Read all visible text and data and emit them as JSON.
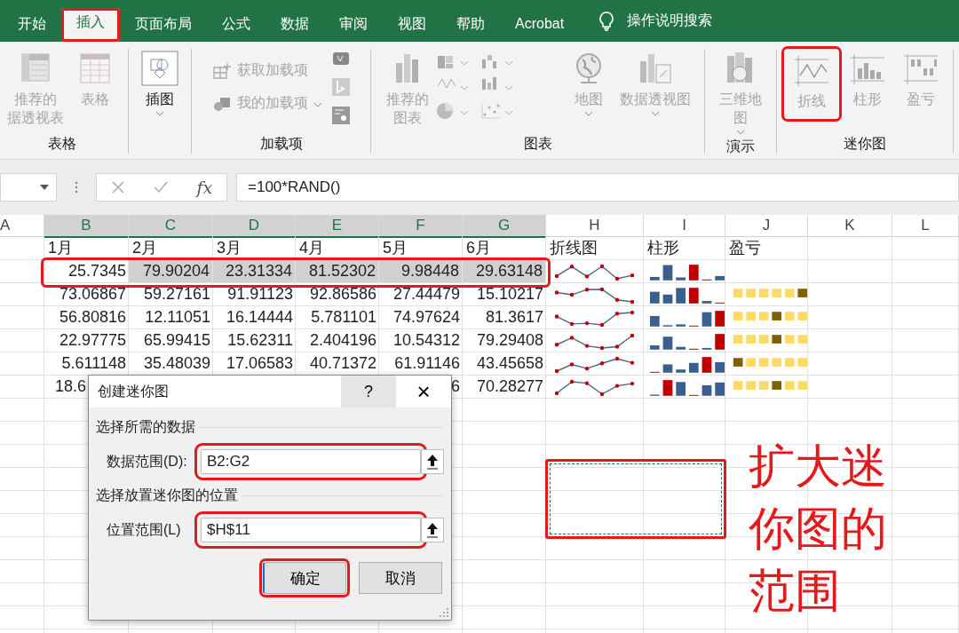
{
  "tabs": [
    {
      "label": "开始",
      "selected": false,
      "marked": false
    },
    {
      "label": "插入",
      "selected": true,
      "marked": true
    },
    {
      "label": "页面布局",
      "selected": false,
      "marked": false
    },
    {
      "label": "公式",
      "selected": false,
      "marked": false
    },
    {
      "label": "数据",
      "selected": false,
      "marked": false
    },
    {
      "label": "审阅",
      "selected": false,
      "marked": false
    },
    {
      "label": "视图",
      "selected": false,
      "marked": false
    },
    {
      "label": "帮助",
      "selected": false,
      "marked": false
    },
    {
      "label": "Acrobat",
      "selected": false,
      "marked": false
    }
  ],
  "tell_me": {
    "label": "操作说明搜索"
  },
  "ribbon": {
    "groups": [
      {
        "label": "表格",
        "items": [
          {
            "kind": "large",
            "lines": [
              "推荐的",
              "据透视表"
            ],
            "disabled": true,
            "dropdown": false,
            "marked": false
          },
          {
            "kind": "large",
            "lines": [
              "表格"
            ],
            "disabled": true,
            "dropdown": false,
            "marked": false
          }
        ]
      },
      {
        "items": [
          {
            "kind": "large",
            "lines": [
              "插图"
            ],
            "disabled": false,
            "dropdown": true,
            "marked": false
          }
        ]
      },
      {
        "label": "加载项",
        "items": [
          {
            "kind": "small-stack",
            "commands": [
              {
                "label": "获取加载项",
                "disabled": true,
                "dropdown": false
              },
              {
                "label": "我的加载项",
                "disabled": true,
                "dropdown": true
              }
            ]
          },
          {
            "kind": "icon-stack"
          }
        ]
      },
      {
        "label": "图表",
        "items": [
          {
            "kind": "large",
            "lines": [
              "推荐的",
              "图表"
            ],
            "disabled": true,
            "dropdown": false,
            "marked": false
          },
          {
            "kind": "chart-gallery"
          },
          {
            "kind": "large",
            "lines": [
              "地图"
            ],
            "disabled": true,
            "dropdown": true,
            "marked": false
          },
          {
            "kind": "large",
            "lines": [
              "数据透视图"
            ],
            "disabled": true,
            "dropdown": true,
            "marked": false
          }
        ]
      },
      {
        "label": "演示",
        "items": [
          {
            "kind": "large",
            "lines": [
              "三维地",
              "图"
            ],
            "disabled": true,
            "dropdown": true,
            "marked": false
          }
        ]
      },
      {
        "label": "迷你图",
        "items": [
          {
            "kind": "large",
            "lines": [
              "折线"
            ],
            "disabled": true,
            "dropdown": false,
            "marked": true
          },
          {
            "kind": "large",
            "lines": [
              "柱形"
            ],
            "disabled": true,
            "dropdown": false,
            "marked": false
          },
          {
            "kind": "large",
            "lines": [
              "盈亏"
            ],
            "disabled": true,
            "dropdown": false,
            "marked": false
          }
        ]
      }
    ]
  },
  "formula_bar": {
    "function_label": "fx",
    "formula": "=100*RAND()"
  },
  "sheet": {
    "columns": [
      {
        "label": "A",
        "selected": false
      },
      {
        "label": "B",
        "selected": true
      },
      {
        "label": "C",
        "selected": true
      },
      {
        "label": "D",
        "selected": true
      },
      {
        "label": "E",
        "selected": true
      },
      {
        "label": "F",
        "selected": true
      },
      {
        "label": "G",
        "selected": true
      },
      {
        "label": "H",
        "selected": false
      },
      {
        "label": "I",
        "selected": false
      },
      {
        "label": "J",
        "selected": false
      },
      {
        "label": "K",
        "selected": false
      },
      {
        "label": "L",
        "selected": false
      }
    ],
    "header_row": [
      "1月",
      "2月",
      "3月",
      "4月",
      "5月",
      "6月"
    ],
    "sparkline_headers": [
      "折线图",
      "柱形",
      "盈亏"
    ],
    "rows": [
      {
        "values": [
          "25.7345",
          "79.90204",
          "23.31334",
          "81.52302",
          "9.98448",
          "29.63148"
        ],
        "selected": true,
        "marked": true,
        "covered": false,
        "sparklines": [
          {
            "kind": "line"
          },
          {
            "kind": "column"
          }
        ]
      },
      {
        "values": [
          "73.06867",
          "59.27161",
          "91.91123",
          "92.86586",
          "27.44479",
          "15.10217"
        ],
        "selected": false,
        "marked": false,
        "covered": false,
        "sparklines": [
          {
            "kind": "line"
          },
          {
            "kind": "column"
          },
          {
            "kind": "winloss"
          }
        ]
      },
      {
        "values": [
          "56.80816",
          "12.11051",
          "16.14444",
          "5.781101",
          "74.97624",
          "81.3617"
        ],
        "selected": false,
        "marked": false,
        "covered": false,
        "sparklines": [
          {
            "kind": "line"
          },
          {
            "kind": "column"
          },
          {
            "kind": "winloss"
          }
        ]
      },
      {
        "values": [
          "22.97775",
          "65.99415",
          "15.62311",
          "2.404196",
          "10.54312",
          "79.29408"
        ],
        "selected": false,
        "marked": false,
        "covered": false,
        "sparklines": [
          {
            "kind": "line"
          },
          {
            "kind": "column"
          },
          {
            "kind": "winloss"
          }
        ]
      },
      {
        "values": [
          "5.611148",
          "35.48039",
          "17.06583",
          "40.71372",
          "61.91146",
          "43.45658"
        ],
        "selected": false,
        "marked": false,
        "covered": false,
        "sparklines": [
          {
            "kind": "line"
          },
          {
            "kind": "column"
          },
          {
            "kind": "winloss"
          }
        ]
      },
      {
        "values": [
          "18.6",
          "6",
          "70.28277"
        ],
        "selected": false,
        "marked": false,
        "covered": true,
        "sparklines": [
          {
            "kind": "line"
          },
          {
            "kind": "column"
          },
          {
            "kind": "winloss"
          }
        ]
      }
    ]
  },
  "dialog": {
    "title": "创建迷你图",
    "help": "?",
    "close": "×",
    "sections": [
      {
        "heading": "选择所需的数据",
        "label": "数据范围(D):",
        "value": "B2:G2",
        "marked": true
      },
      {
        "heading": "选择放置迷你图的位置",
        "label": "位置范围(L)",
        "value": "$H$11",
        "marked": true
      }
    ],
    "buttons": [
      {
        "label": "确定",
        "default": true,
        "marked": true
      },
      {
        "label": "取消",
        "default": false,
        "marked": false
      }
    ]
  },
  "annotation": "扩大迷你图的范围"
}
